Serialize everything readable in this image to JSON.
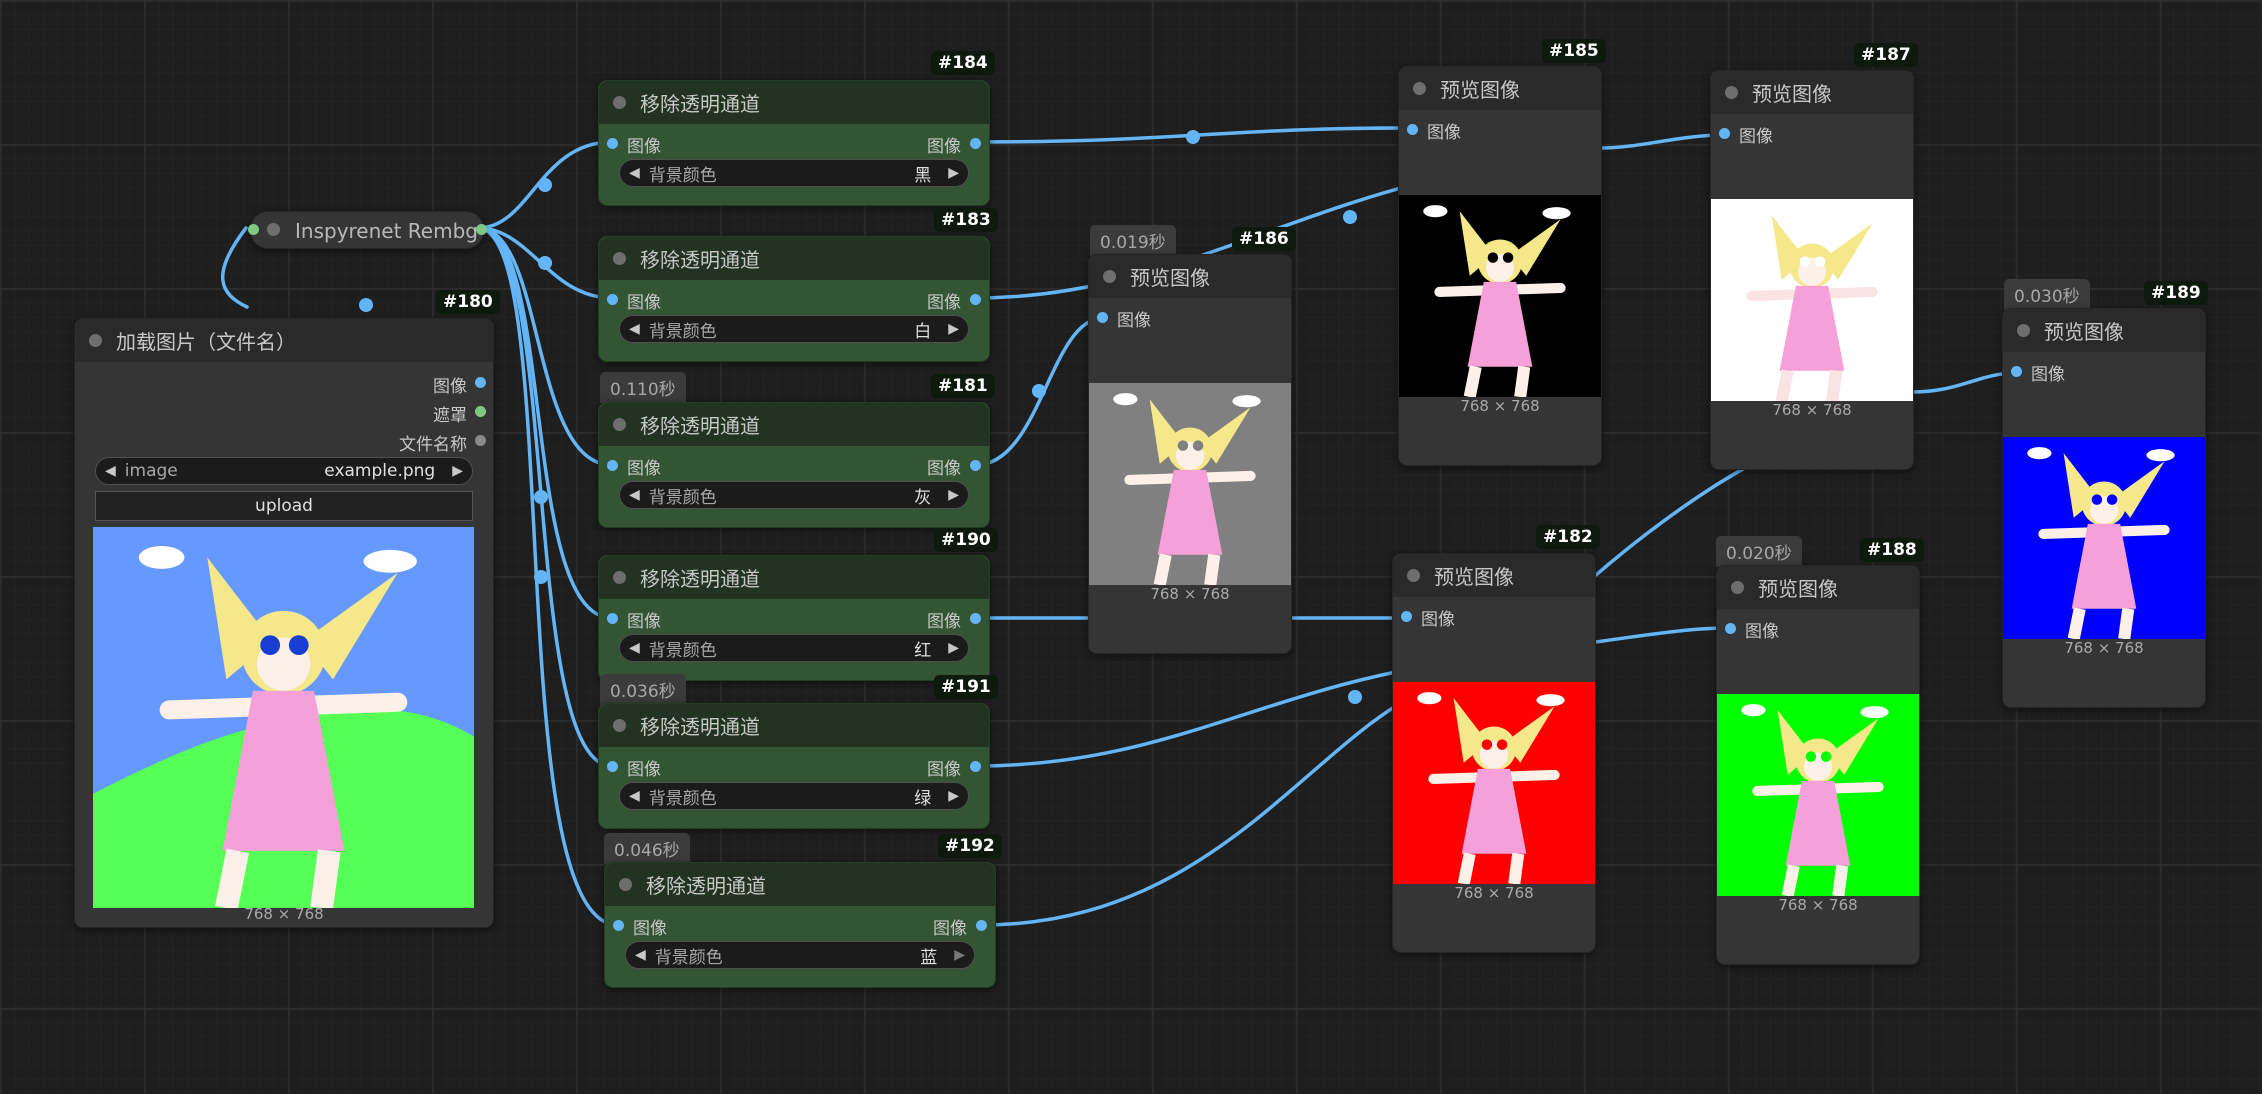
{
  "colors": {
    "link": "#64b5f6",
    "canvas_bg": "#1e1e1e",
    "node_gray": "#353535",
    "node_green": "#335533",
    "bg_black": "#000000",
    "bg_white": "#ffffff",
    "bg_gray": "#808080",
    "bg_red": "#ff0000",
    "bg_green": "#00ff00",
    "bg_blue": "#0000ff",
    "source_sky": "#6699ff",
    "source_grass": "#55ff55"
  },
  "load_node": {
    "id": "#180",
    "title": "加载图片（文件名）",
    "outputs": [
      "图像",
      "遮罩",
      "文件名称"
    ],
    "image_widget": {
      "label": "image",
      "value": "example.png"
    },
    "upload_label": "upload",
    "dims": "768 × 768"
  },
  "rembg_node": {
    "title": "Inspyrenet Rembg"
  },
  "remove_alpha_nodes": [
    {
      "id": "#184",
      "time": "",
      "title": "移除透明通道",
      "input": "图像",
      "output": "图像",
      "widget_label": "背景颜色",
      "widget_value": "黑"
    },
    {
      "id": "#183",
      "time": "",
      "title": "移除透明通道",
      "input": "图像",
      "output": "图像",
      "widget_label": "背景颜色",
      "widget_value": "白"
    },
    {
      "id": "#181",
      "time": "0.110秒",
      "title": "移除透明通道",
      "input": "图像",
      "output": "图像",
      "widget_label": "背景颜色",
      "widget_value": "灰"
    },
    {
      "id": "#190",
      "time": "",
      "title": "移除透明通道",
      "input": "图像",
      "output": "图像",
      "widget_label": "背景颜色",
      "widget_value": "红"
    },
    {
      "id": "#191",
      "time": "0.036秒",
      "title": "移除透明通道",
      "input": "图像",
      "output": "图像",
      "widget_label": "背景颜色",
      "widget_value": "绿"
    },
    {
      "id": "#192",
      "time": "0.046秒",
      "title": "移除透明通道",
      "input": "图像",
      "output": "图像",
      "widget_label": "背景颜色",
      "widget_value": "蓝"
    }
  ],
  "preview_nodes": [
    {
      "id": "#186",
      "time": "0.019秒",
      "title": "预览图像",
      "input": "图像",
      "dims": "768 × 768",
      "bg": "gray"
    },
    {
      "id": "#185",
      "time": "",
      "title": "预览图像",
      "input": "图像",
      "dims": "768 × 768",
      "bg": "black"
    },
    {
      "id": "#187",
      "time": "",
      "title": "预览图像",
      "input": "图像",
      "dims": "768 × 768",
      "bg": "white"
    },
    {
      "id": "#182",
      "time": "",
      "title": "预览图像",
      "input": "图像",
      "dims": "768 × 768",
      "bg": "red"
    },
    {
      "id": "#188",
      "time": "0.020秒",
      "title": "预览图像",
      "input": "图像",
      "dims": "768 × 768",
      "bg": "green"
    },
    {
      "id": "#189",
      "time": "0.030秒",
      "title": "预览图像",
      "input": "图像",
      "dims": "768 × 768",
      "bg": "blue"
    }
  ]
}
